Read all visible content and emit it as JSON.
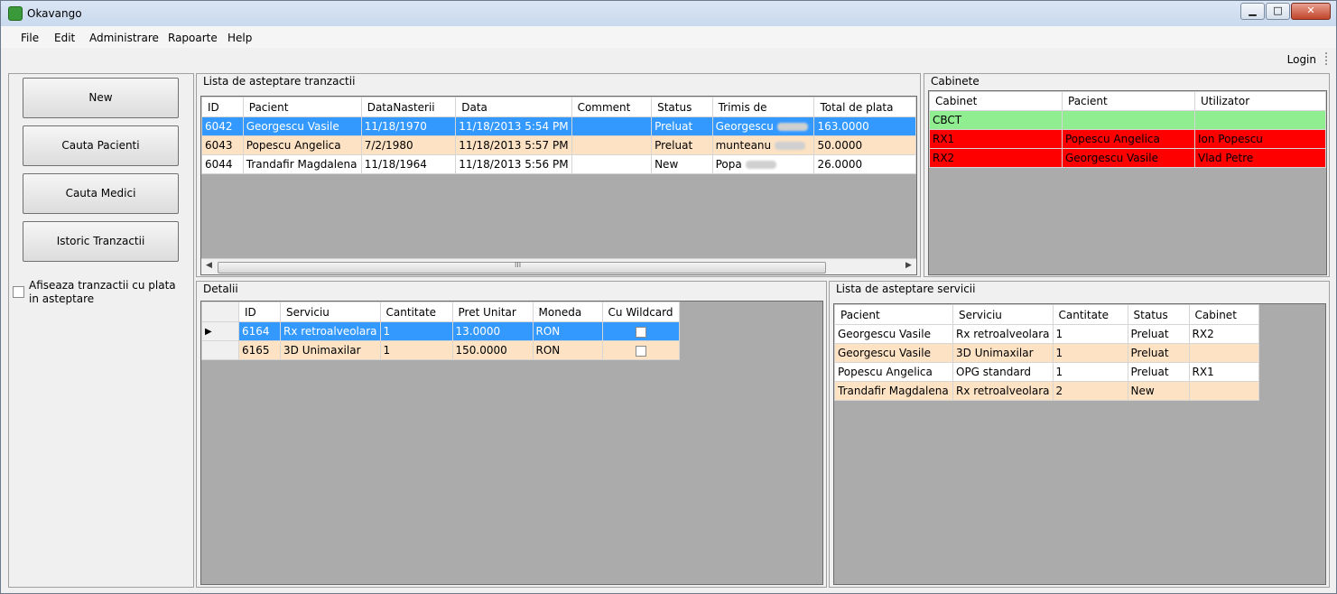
{
  "window": {
    "title": "Okavango",
    "minimize": "▁",
    "maximize": "□",
    "close": "✕"
  },
  "menu": [
    "File",
    "Edit",
    "Administrare",
    "Rapoarte",
    "Help"
  ],
  "toolbar": {
    "login": "Login"
  },
  "left": {
    "buttons": [
      "New",
      "Cauta Pacienti",
      "Cauta Medici",
      "Istoric Tranzactii"
    ],
    "checkbox_label": "Afiseaza tranzactii cu plata in asteptare",
    "checkbox_checked": false
  },
  "tranzactii": {
    "title": "Lista de asteptare tranzactii",
    "columns": [
      "ID",
      "Pacient",
      "DataNasterii",
      "Data",
      "Comment",
      "Status",
      "Trimis de",
      "Total de plata"
    ],
    "rows": [
      {
        "id": "6042",
        "pacient": "Georgescu Vasile",
        "data_nasterii": "11/18/1970",
        "data": "11/18/2013 5:54 PM",
        "comment": "",
        "status": "Preluat",
        "trimis_de": "Georgescu",
        "total": "163.0000"
      },
      {
        "id": "6043",
        "pacient": "Popescu Angelica",
        "data_nasterii": "7/2/1980",
        "data": "11/18/2013 5:57 PM",
        "comment": "",
        "status": "Preluat",
        "trimis_de": "munteanu",
        "total": "50.0000"
      },
      {
        "id": "6044",
        "pacient": "Trandafir Magdalena",
        "data_nasterii": "11/18/1964",
        "data": "11/18/2013 5:56 PM",
        "comment": "",
        "status": "New",
        "trimis_de": "Popa",
        "total": "26.0000"
      }
    ],
    "scroll_mark": "III"
  },
  "cabinete": {
    "title": "Cabinete",
    "columns": [
      "Cabinet",
      "Pacient",
      "Utilizator"
    ],
    "rows": [
      {
        "cabinet": "CBCT",
        "pacient": "",
        "utilizator": "",
        "state": "free"
      },
      {
        "cabinet": "RX1",
        "pacient": "Popescu Angelica",
        "utilizator": "Ion Popescu",
        "state": "busy"
      },
      {
        "cabinet": "RX2",
        "pacient": "Georgescu Vasile",
        "utilizator": "Vlad Petre",
        "state": "busy"
      }
    ],
    "colors": {
      "free": "#90ee90",
      "busy": "#ff0000"
    }
  },
  "detalii": {
    "title": "Detalii",
    "columns": [
      "ID",
      "Serviciu",
      "Cantitate",
      "Pret Unitar",
      "Moneda",
      "Cu Wildcard"
    ],
    "rows": [
      {
        "id": "6164",
        "serviciu": "Rx retroalveolara",
        "cantitate": "1",
        "pret": "13.0000",
        "moneda": "RON",
        "wildcard": false
      },
      {
        "id": "6165",
        "serviciu": "3D Unimaxilar",
        "cantitate": "1",
        "pret": "150.0000",
        "moneda": "RON",
        "wildcard": false
      }
    ]
  },
  "servicii": {
    "title": "Lista de asteptare servicii",
    "columns": [
      "Pacient",
      "Serviciu",
      "Cantitate",
      "Status",
      "Cabinet"
    ],
    "rows": [
      {
        "pacient": "Georgescu Vasile",
        "serviciu": "Rx retroalveolara",
        "cantitate": "1",
        "status": "Preluat",
        "cabinet": "RX2"
      },
      {
        "pacient": "Georgescu Vasile",
        "serviciu": "3D Unimaxilar",
        "cantitate": "1",
        "status": "Preluat",
        "cabinet": ""
      },
      {
        "pacient": "Popescu Angelica",
        "serviciu": "OPG standard",
        "cantitate": "1",
        "status": "Preluat",
        "cabinet": "RX1"
      },
      {
        "pacient": "Trandafir Magdalena",
        "serviciu": "Rx retroalveolara",
        "cantitate": "2",
        "status": "New",
        "cabinet": ""
      }
    ]
  },
  "colors": {
    "selection": "#3399ff",
    "alt_row": "#fde2c4",
    "grid_bg": "#ababab"
  }
}
